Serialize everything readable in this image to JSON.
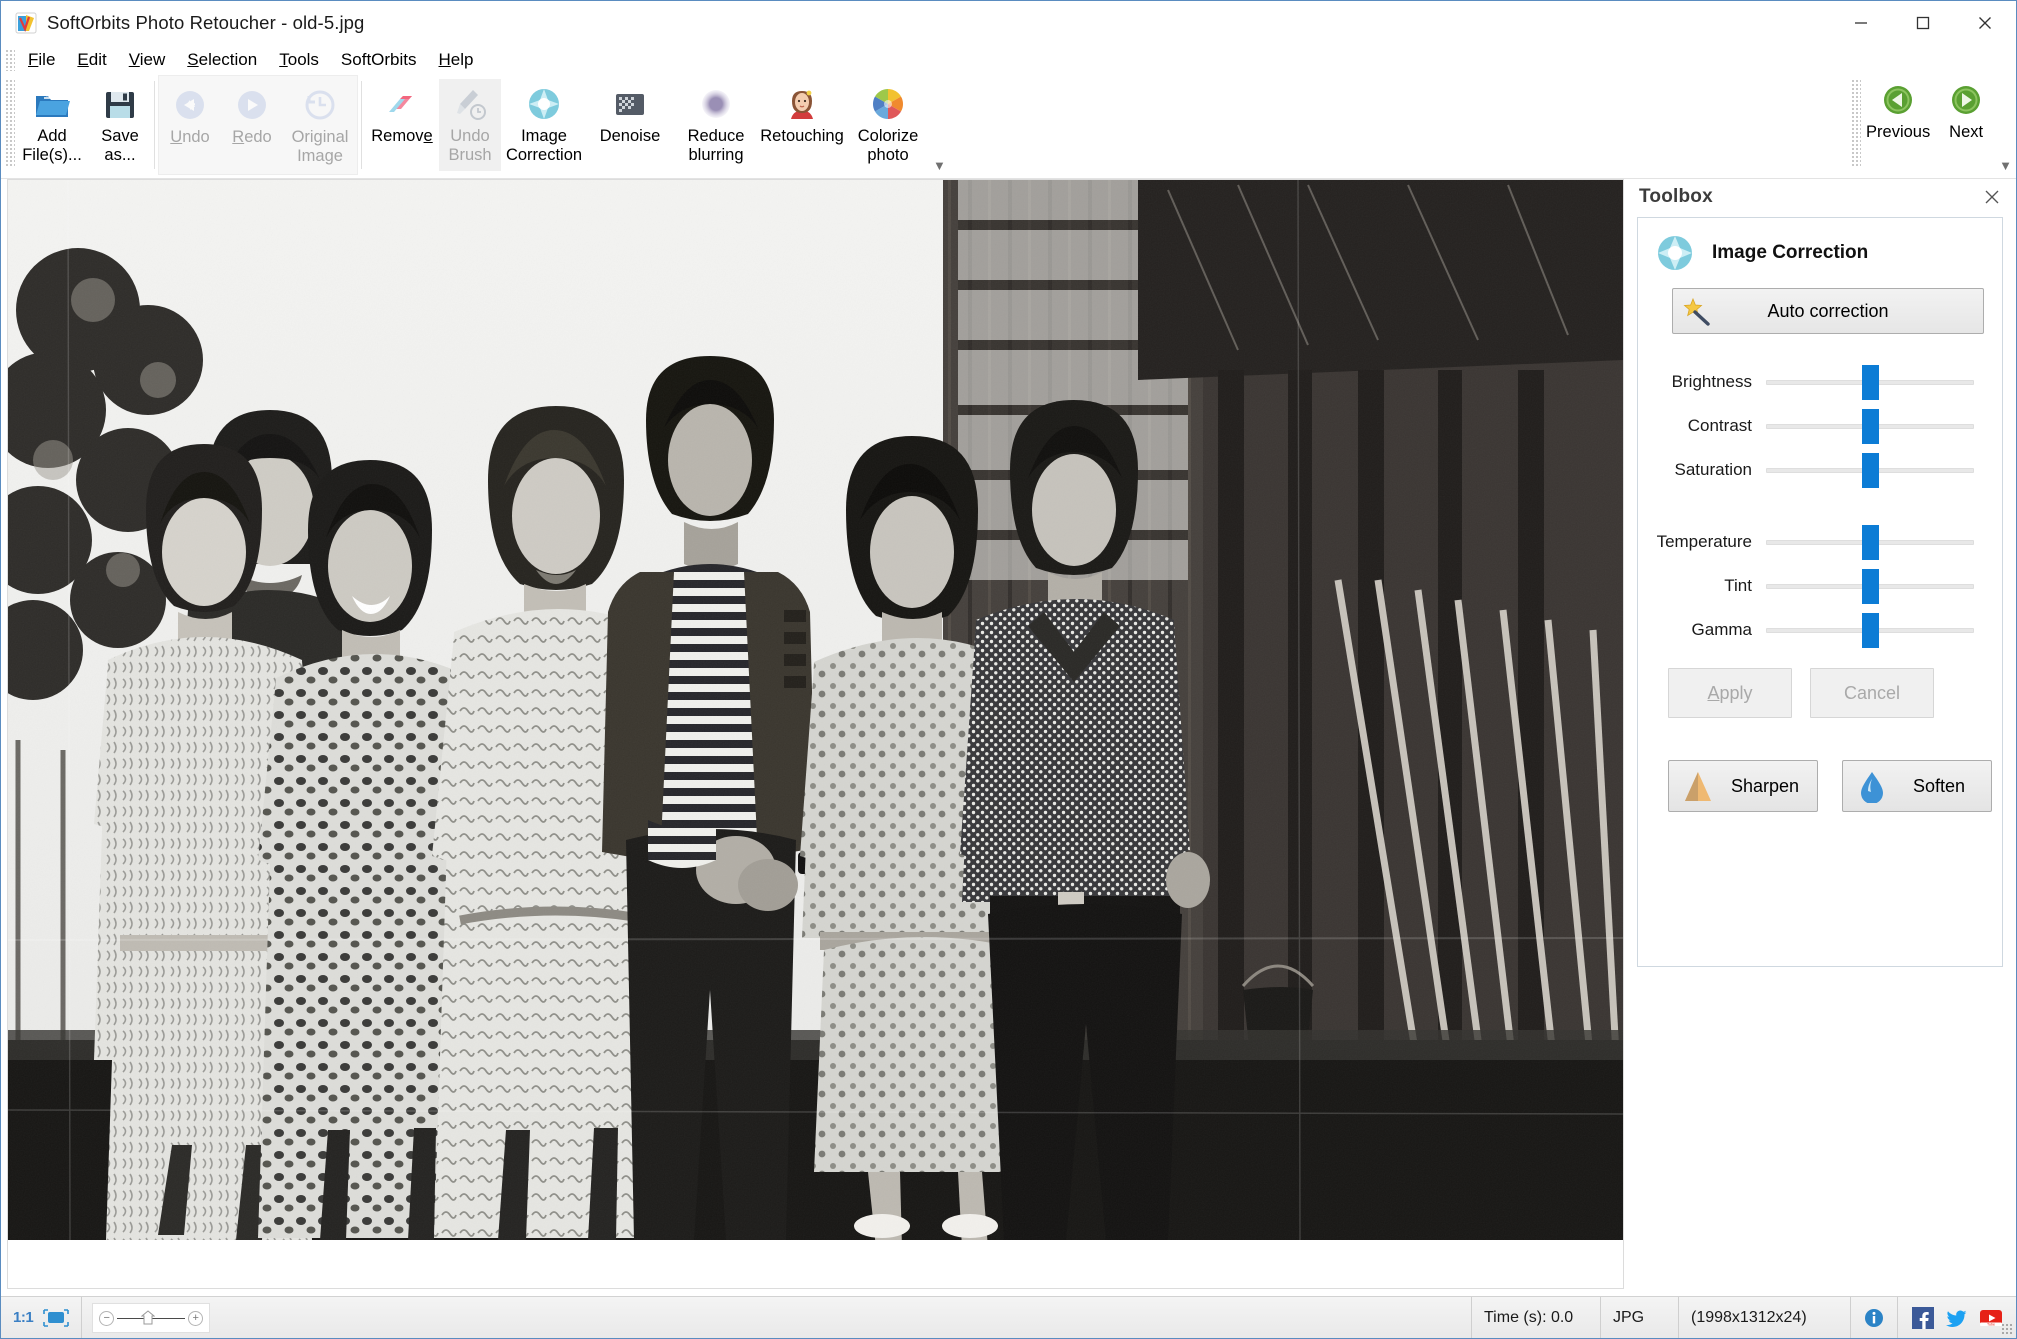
{
  "window": {
    "title": "SoftOrbits Photo Retoucher - old-5.jpg",
    "app_icon": "app-logo-icon",
    "minimize": "—",
    "maximize": "☐",
    "close": "✕"
  },
  "menubar": {
    "items": [
      {
        "label": "File",
        "mnemonic": "F"
      },
      {
        "label": "Edit",
        "mnemonic": "E"
      },
      {
        "label": "View",
        "mnemonic": "V"
      },
      {
        "label": "Selection",
        "mnemonic": "S"
      },
      {
        "label": "Tools",
        "mnemonic": "T"
      },
      {
        "label": "SoftOrbits",
        "mnemonic": ""
      },
      {
        "label": "Help",
        "mnemonic": "H"
      }
    ]
  },
  "toolbar": {
    "buttons": [
      {
        "label": "Add\nFile(s)...",
        "icon": "open-folder-icon",
        "enabled": true
      },
      {
        "label": "Save\nas...",
        "icon": "floppy-save-icon",
        "enabled": true
      },
      {
        "label": "Undo",
        "icon": "undo-arrow-icon",
        "enabled": false
      },
      {
        "label": "Redo",
        "icon": "redo-arrow-icon",
        "enabled": false
      },
      {
        "label": "Original\nImage",
        "icon": "clock-history-icon",
        "enabled": false
      },
      {
        "label": "Remove",
        "icon": "eraser-icon",
        "enabled": true
      },
      {
        "label": "Undo\nBrush",
        "icon": "brush-undo-icon",
        "enabled": false
      },
      {
        "label": "Image\nCorrection",
        "icon": "image-correction-icon",
        "enabled": true
      },
      {
        "label": "Denoise",
        "icon": "denoise-icon",
        "enabled": true
      },
      {
        "label": "Reduce\nblurring",
        "icon": "reduce-blur-icon",
        "enabled": true
      },
      {
        "label": "Retouching",
        "icon": "retouching-face-icon",
        "enabled": true
      },
      {
        "label": "Colorize\nphoto",
        "icon": "color-wheel-icon",
        "enabled": true
      }
    ],
    "nav": [
      {
        "label": "Previous",
        "icon": "green-left-arrow-icon"
      },
      {
        "label": "Next",
        "icon": "green-right-arrow-icon"
      }
    ],
    "overflow_glyph": "▼"
  },
  "toolbox": {
    "title": "Toolbox",
    "close_glyph": "✕",
    "panel": {
      "icon": "image-correction-icon",
      "title": "Image Correction",
      "auto_button": {
        "label": "Auto correction",
        "icon": "magic-wand-icon"
      },
      "sliders": [
        {
          "label": "Brightness",
          "value": 50
        },
        {
          "label": "Contrast",
          "value": 50
        },
        {
          "label": "Saturation",
          "value": 50
        },
        {
          "label": "Temperature",
          "value": 50
        },
        {
          "label": "Tint",
          "value": 50
        },
        {
          "label": "Gamma",
          "value": 50
        }
      ],
      "apply_label": "Apply",
      "apply_mnemonic": "A",
      "cancel_label": "Cancel",
      "sharpen_label": "Sharpen",
      "sharpen_icon": "sharpen-triangle-icon",
      "soften_label": "Soften",
      "soften_icon": "soften-droplet-icon"
    }
  },
  "statusbar": {
    "zoom_ratio": "1:1",
    "fit_icon": "fit-to-window-icon",
    "zoom_out_glyph": "−",
    "zoom_home_icon": "zoom-home-icon",
    "zoom_in_glyph": "+",
    "time": "Time (s): 0.0",
    "format": "JPG",
    "dimensions": "(1998x1312x24)",
    "info_icon": "info-icon",
    "facebook_icon": "facebook-icon",
    "twitter_icon": "twitter-icon",
    "youtube_icon": "youtube-icon"
  },
  "colors": {
    "accent_blue": "#0c7cd5",
    "title_border": "#5a8cc0",
    "green_nav": "#5aa032",
    "facebook": "#3b5998",
    "twitter": "#1da1f2",
    "youtube": "#e62117"
  }
}
